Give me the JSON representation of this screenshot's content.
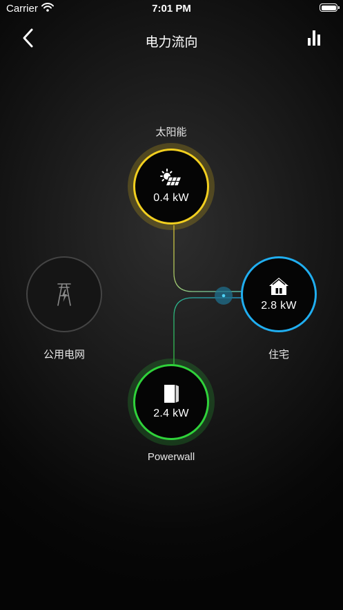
{
  "status_bar": {
    "carrier": "Carrier",
    "time": "7:01 PM"
  },
  "nav": {
    "title": "电力流向",
    "back_icon": "chevron-left-icon",
    "stats_icon": "bar-chart-icon"
  },
  "nodes": {
    "solar": {
      "label": "太阳能",
      "value": "0.4 kW",
      "color": "#f2cf1f",
      "icon": "solar-panel-icon"
    },
    "home": {
      "label": "住宅",
      "value": "2.8 kW",
      "color": "#20aef0",
      "icon": "home-icon"
    },
    "grid": {
      "label": "公用电网",
      "color": "#444444",
      "icon": "power-tower-icon"
    },
    "powerwall": {
      "label": "Powerwall",
      "value": "2.4 kW",
      "color": "#2fd23a",
      "icon": "powerwall-icon"
    }
  }
}
